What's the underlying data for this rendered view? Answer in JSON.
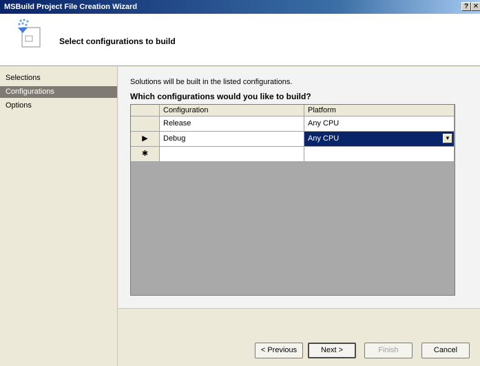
{
  "window": {
    "title": "MSBuild Project File Creation Wizard",
    "help_glyph": "?",
    "close_glyph": "✕"
  },
  "header": {
    "title": "Select configurations to build"
  },
  "nav": {
    "items": [
      "Selections",
      "Configurations",
      "Options"
    ],
    "selected": "Configurations"
  },
  "content": {
    "hint": "Solutions will be built in the listed configurations.",
    "question": "Which configurations would you like to build?"
  },
  "grid": {
    "columns": [
      "Configuration",
      "Platform"
    ],
    "rows": [
      {
        "indicator": "",
        "configuration": "Release",
        "platform": "Any CPU"
      },
      {
        "indicator": "▶",
        "configuration": "Debug",
        "platform": "Any CPU"
      }
    ],
    "new_row_indicator": "✱"
  },
  "buttons": {
    "previous": "< Previous",
    "next": "Next >",
    "finish": "Finish",
    "cancel": "Cancel"
  },
  "colors": {
    "title_bar": "#0a246a",
    "selection": "#0a246a",
    "nav_selected": "#7f7b72"
  }
}
